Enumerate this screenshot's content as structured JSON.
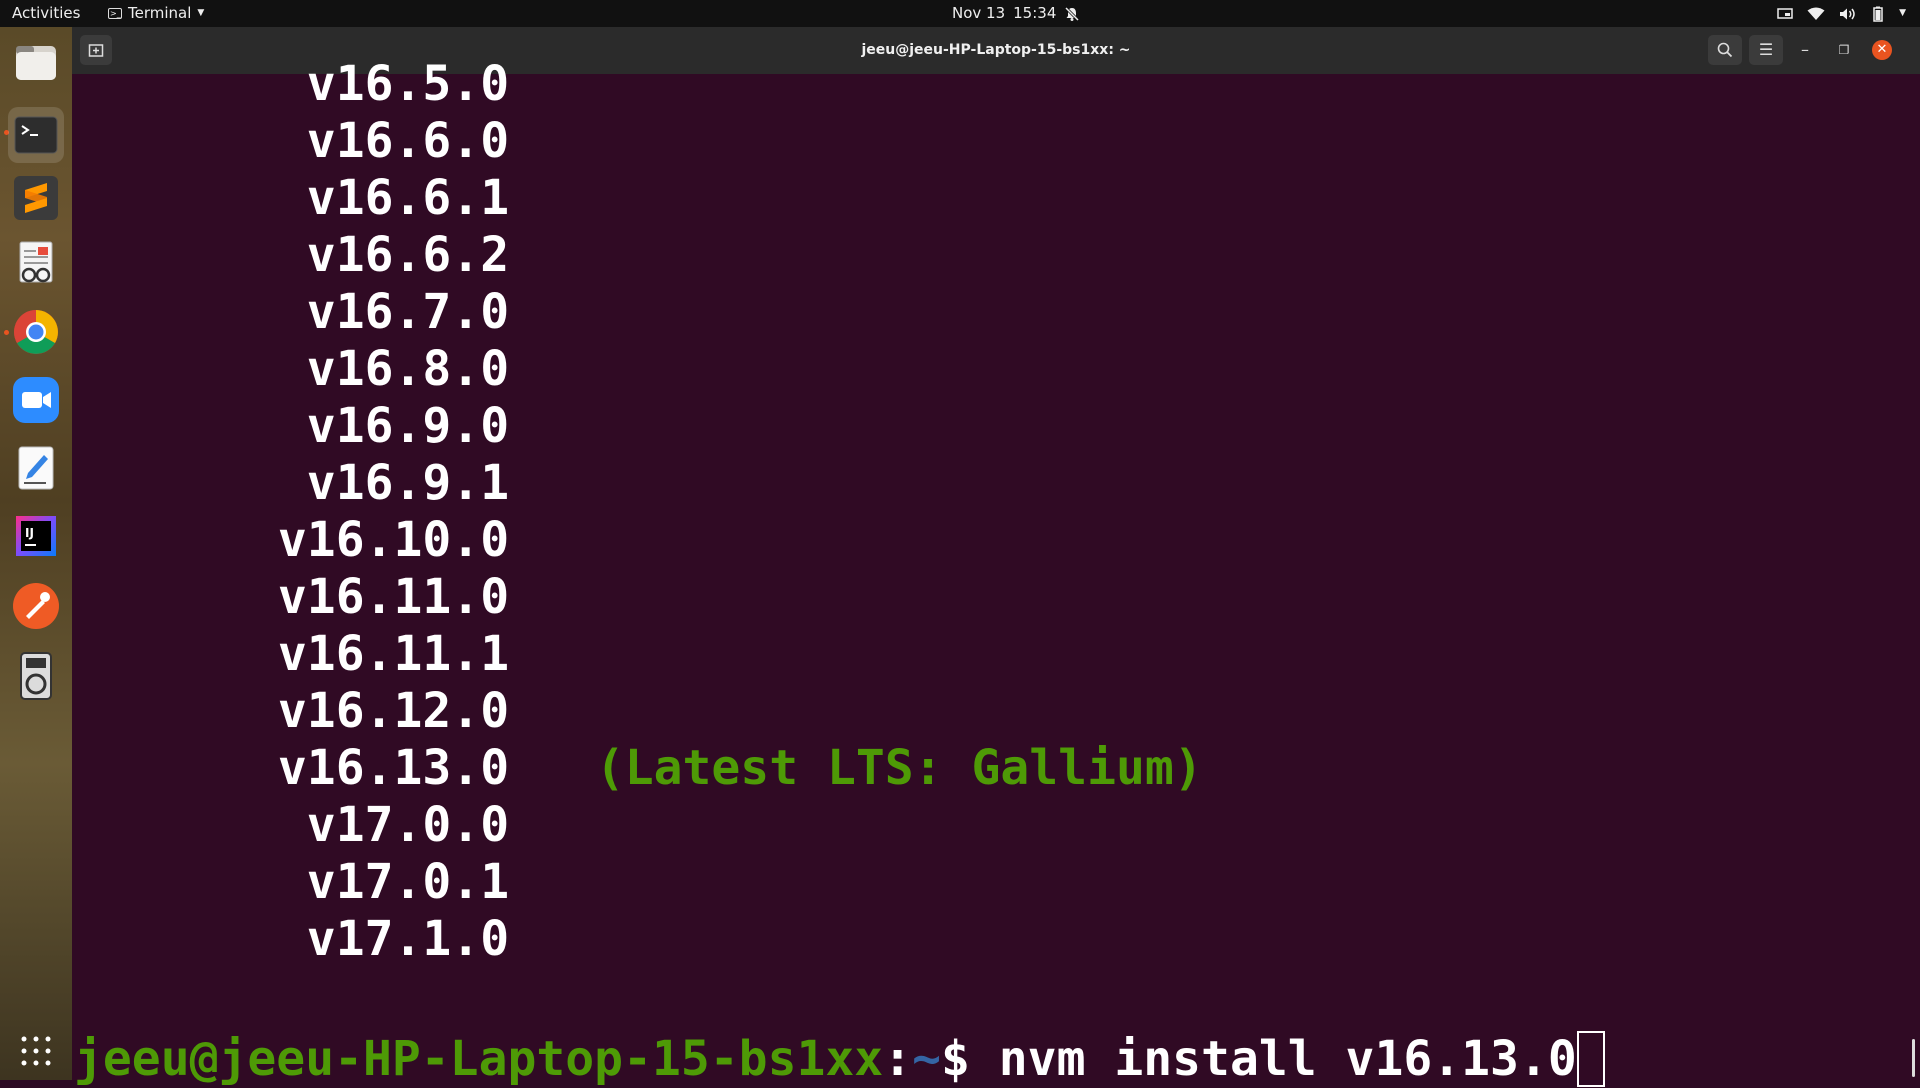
{
  "topbar": {
    "activities": "Activities",
    "app_name": "Terminal",
    "date": "Nov 13",
    "time": "15:34",
    "icons": [
      "notifications-muted-icon",
      "screen-icon",
      "wifi-icon",
      "volume-icon",
      "battery-icon",
      "system-menu-caret-icon"
    ]
  },
  "dock": {
    "apps": [
      {
        "name": "files-app",
        "icon": "folder-icon"
      },
      {
        "name": "terminal-app",
        "icon": "terminal-icon"
      },
      {
        "name": "sublime-text-app",
        "icon": "sublime-icon"
      },
      {
        "name": "document-viewer-app",
        "icon": "document-viewer-icon"
      },
      {
        "name": "chrome-app",
        "icon": "chrome-icon"
      },
      {
        "name": "zoom-app",
        "icon": "zoom-icon"
      },
      {
        "name": "text-editor-app",
        "icon": "text-editor-icon"
      },
      {
        "name": "intellij-app",
        "icon": "intellij-icon"
      },
      {
        "name": "postman-app",
        "icon": "postman-icon"
      },
      {
        "name": "music-player-app",
        "icon": "music-player-icon"
      }
    ],
    "show_apps_icon": "app-grid-icon"
  },
  "window": {
    "title": "jeeu@jeeu-HP-Laptop-15-bs1xx: ~"
  },
  "terminal": {
    "versions": [
      {
        "text": "  v16.5.0",
        "note": ""
      },
      {
        "text": "  v16.6.0",
        "note": ""
      },
      {
        "text": "  v16.6.1",
        "note": ""
      },
      {
        "text": "  v16.6.2",
        "note": ""
      },
      {
        "text": "  v16.7.0",
        "note": ""
      },
      {
        "text": "  v16.8.0",
        "note": ""
      },
      {
        "text": "  v16.9.0",
        "note": ""
      },
      {
        "text": "  v16.9.1",
        "note": ""
      },
      {
        "text": " v16.10.0",
        "note": ""
      },
      {
        "text": " v16.11.0",
        "note": ""
      },
      {
        "text": " v16.11.1",
        "note": ""
      },
      {
        "text": " v16.12.0",
        "note": ""
      },
      {
        "text": " v16.13.0",
        "note": "(Latest LTS: Gallium)"
      },
      {
        "text": "  v17.0.0",
        "note": ""
      },
      {
        "text": "  v17.0.1",
        "note": ""
      },
      {
        "text": "  v17.1.0",
        "note": ""
      }
    ],
    "prompt": {
      "user_host": "jeeu@jeeu-HP-Laptop-15-bs1xx",
      "colon": ":",
      "path": "~",
      "dollar": "$ ",
      "command": "nvm install v16.13.0"
    }
  }
}
